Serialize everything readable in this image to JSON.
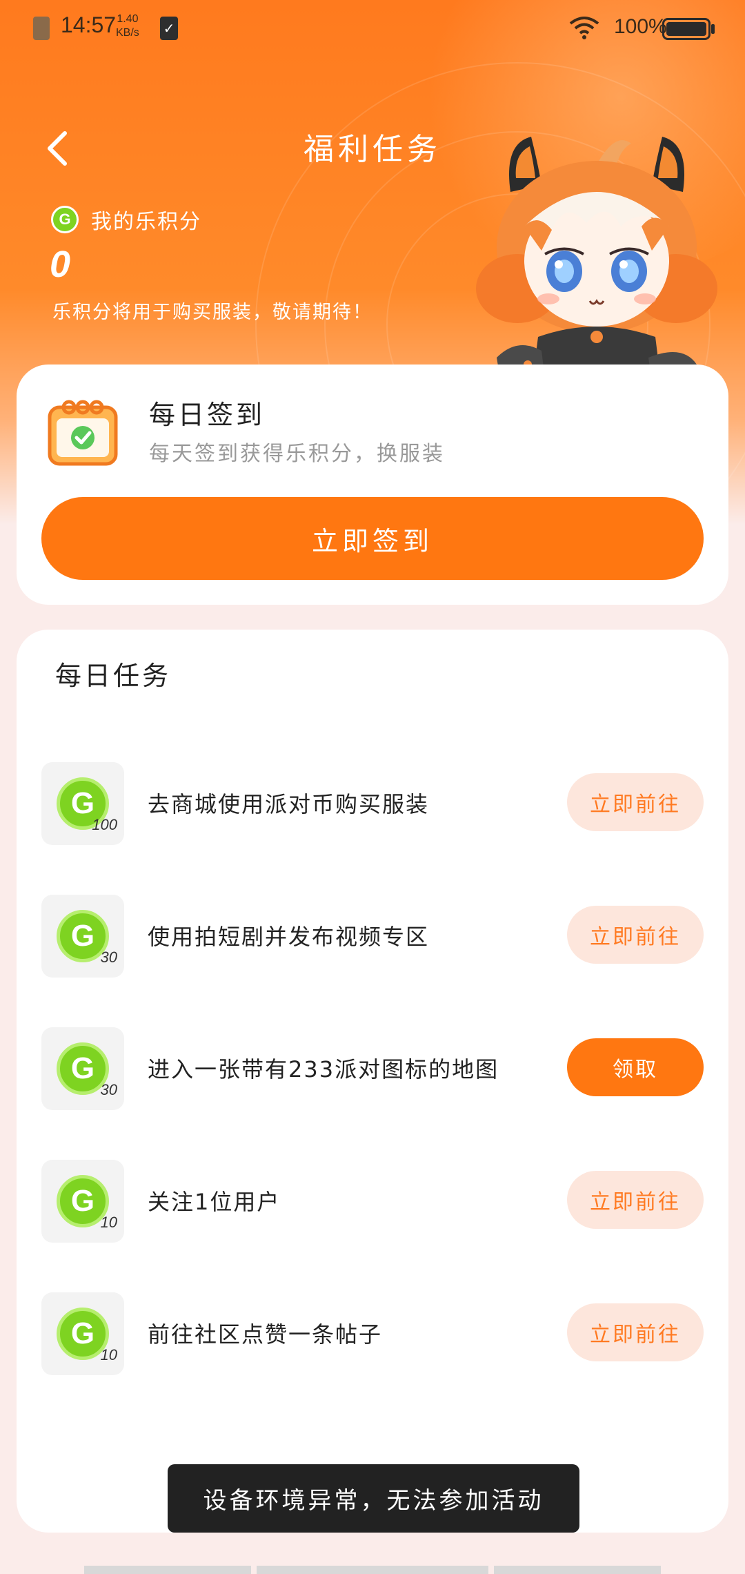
{
  "status_bar": {
    "time": "14:57",
    "speed_value": "1.40",
    "speed_unit": "KB/s",
    "battery": "100%"
  },
  "header": {
    "title": "福利任务",
    "points_label": "我的乐积分",
    "points_value": "0",
    "points_note": "乐积分将用于购买服装，敬请期待！"
  },
  "sign_in": {
    "title": "每日签到",
    "subtitle": "每天签到获得乐积分，换服装",
    "button": "立即签到"
  },
  "daily_tasks": {
    "title": "每日任务",
    "items": [
      {
        "reward": "100",
        "label": "去商城使用派对币购买服装",
        "button": "立即前往",
        "style": "go"
      },
      {
        "reward": "30",
        "label": "使用拍短剧并发布视频专区",
        "button": "立即前往",
        "style": "go"
      },
      {
        "reward": "30",
        "label": "进入一张带有233派对图标的地图",
        "button": "领取",
        "style": "claim"
      },
      {
        "reward": "10",
        "label": "关注1位用户",
        "button": "立即前往",
        "style": "go"
      },
      {
        "reward": "10",
        "label": "前往社区点赞一条帖子",
        "button": "立即前往",
        "style": "go"
      }
    ]
  },
  "toast": "设备环境异常，无法参加活动",
  "colors": {
    "brand_orange": "#ff7711",
    "coin_green": "#7ed321",
    "go_button_bg": "#fde6dc"
  }
}
